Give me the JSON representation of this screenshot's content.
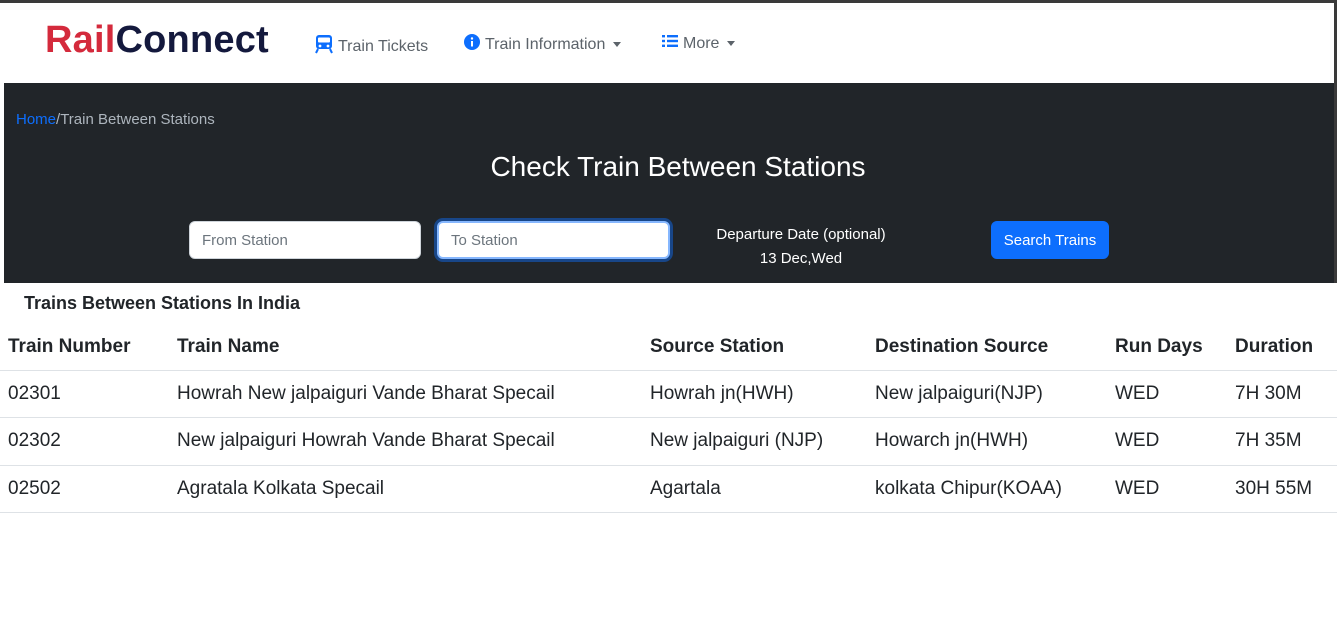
{
  "brand": {
    "part1": "Rail",
    "part2": "Connect"
  },
  "nav": {
    "tickets": "Train Tickets",
    "info": "Train Information",
    "more": "More"
  },
  "breadcrumb": {
    "home": "Home",
    "separator": "/",
    "current": "Train Between Stations"
  },
  "hero": {
    "title": "Check Train Between Stations",
    "from_placeholder": "From Station",
    "to_placeholder": "To Station",
    "departure_label": "Departure Date (optional)",
    "departure_value": "13 Dec,Wed",
    "search_label": "Search Trains"
  },
  "results": {
    "title": "Trains Between Stations In India",
    "headers": [
      "Train Number",
      "Train Name",
      "Source Station",
      "Destination Source",
      "Run Days",
      "Duration"
    ],
    "rows": [
      [
        "02301",
        "Howrah New jalpaiguri Vande Bharat Specail",
        "Howrah jn(HWH)",
        "New jalpaiguri(NJP)",
        "WED",
        "7H 30M"
      ],
      [
        "02302",
        "New jalpaiguri Howrah Vande Bharat Specail",
        "New jalpaiguri (NJP)",
        "Howarch jn(HWH)",
        "WED",
        "7H 35M"
      ],
      [
        "02502",
        "Agratala Kolkata Specail",
        "Agartala",
        "kolkata Chipur(KOAA)",
        "WED",
        "30H 55M"
      ]
    ]
  },
  "colors": {
    "brand_red": "#d42a3c",
    "brand_navy": "#14193d",
    "hero_bg": "#212529",
    "primary": "#0d6efd"
  },
  "icons": {
    "tickets": "train-icon",
    "info": "info-circle-icon",
    "more": "list-icon"
  }
}
